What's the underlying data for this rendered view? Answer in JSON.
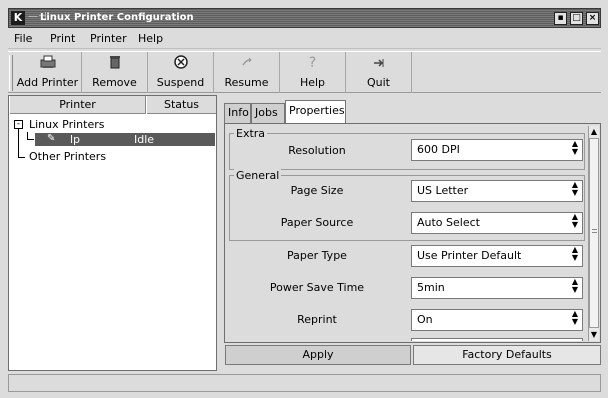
{
  "window": {
    "title": "Linux Printer Configuration",
    "logo_letter": "K"
  },
  "menu": [
    "File",
    "Print",
    "Printer",
    "Help"
  ],
  "toolbar": {
    "add_printer": "Add Printer",
    "remove": "Remove",
    "suspend": "Suspend",
    "resume": "Resume",
    "help": "Help",
    "quit": "Quit"
  },
  "printer_list": {
    "columns": [
      "Printer",
      "Status"
    ],
    "groups": [
      {
        "label": "Linux Printers",
        "items": [
          {
            "name": "lp",
            "status": "Idle"
          }
        ]
      },
      {
        "label": "Other Printers",
        "items": []
      }
    ]
  },
  "tabs": [
    "Info",
    "Jobs",
    "Properties"
  ],
  "active_tab": "Properties",
  "properties": {
    "extra_title": "Extra",
    "general_title": "General",
    "rows": [
      {
        "label": "Resolution",
        "value": "600 DPI"
      },
      {
        "label": "Page Size",
        "value": "US Letter"
      },
      {
        "label": "Paper Source",
        "value": "Auto Select"
      },
      {
        "label": "Paper Type",
        "value": "Use Printer Default"
      },
      {
        "label": "Power Save Time",
        "value": "5min"
      },
      {
        "label": "Reprint",
        "value": "On"
      }
    ]
  },
  "buttons": {
    "apply": "Apply",
    "factory_defaults": "Factory Defaults"
  }
}
